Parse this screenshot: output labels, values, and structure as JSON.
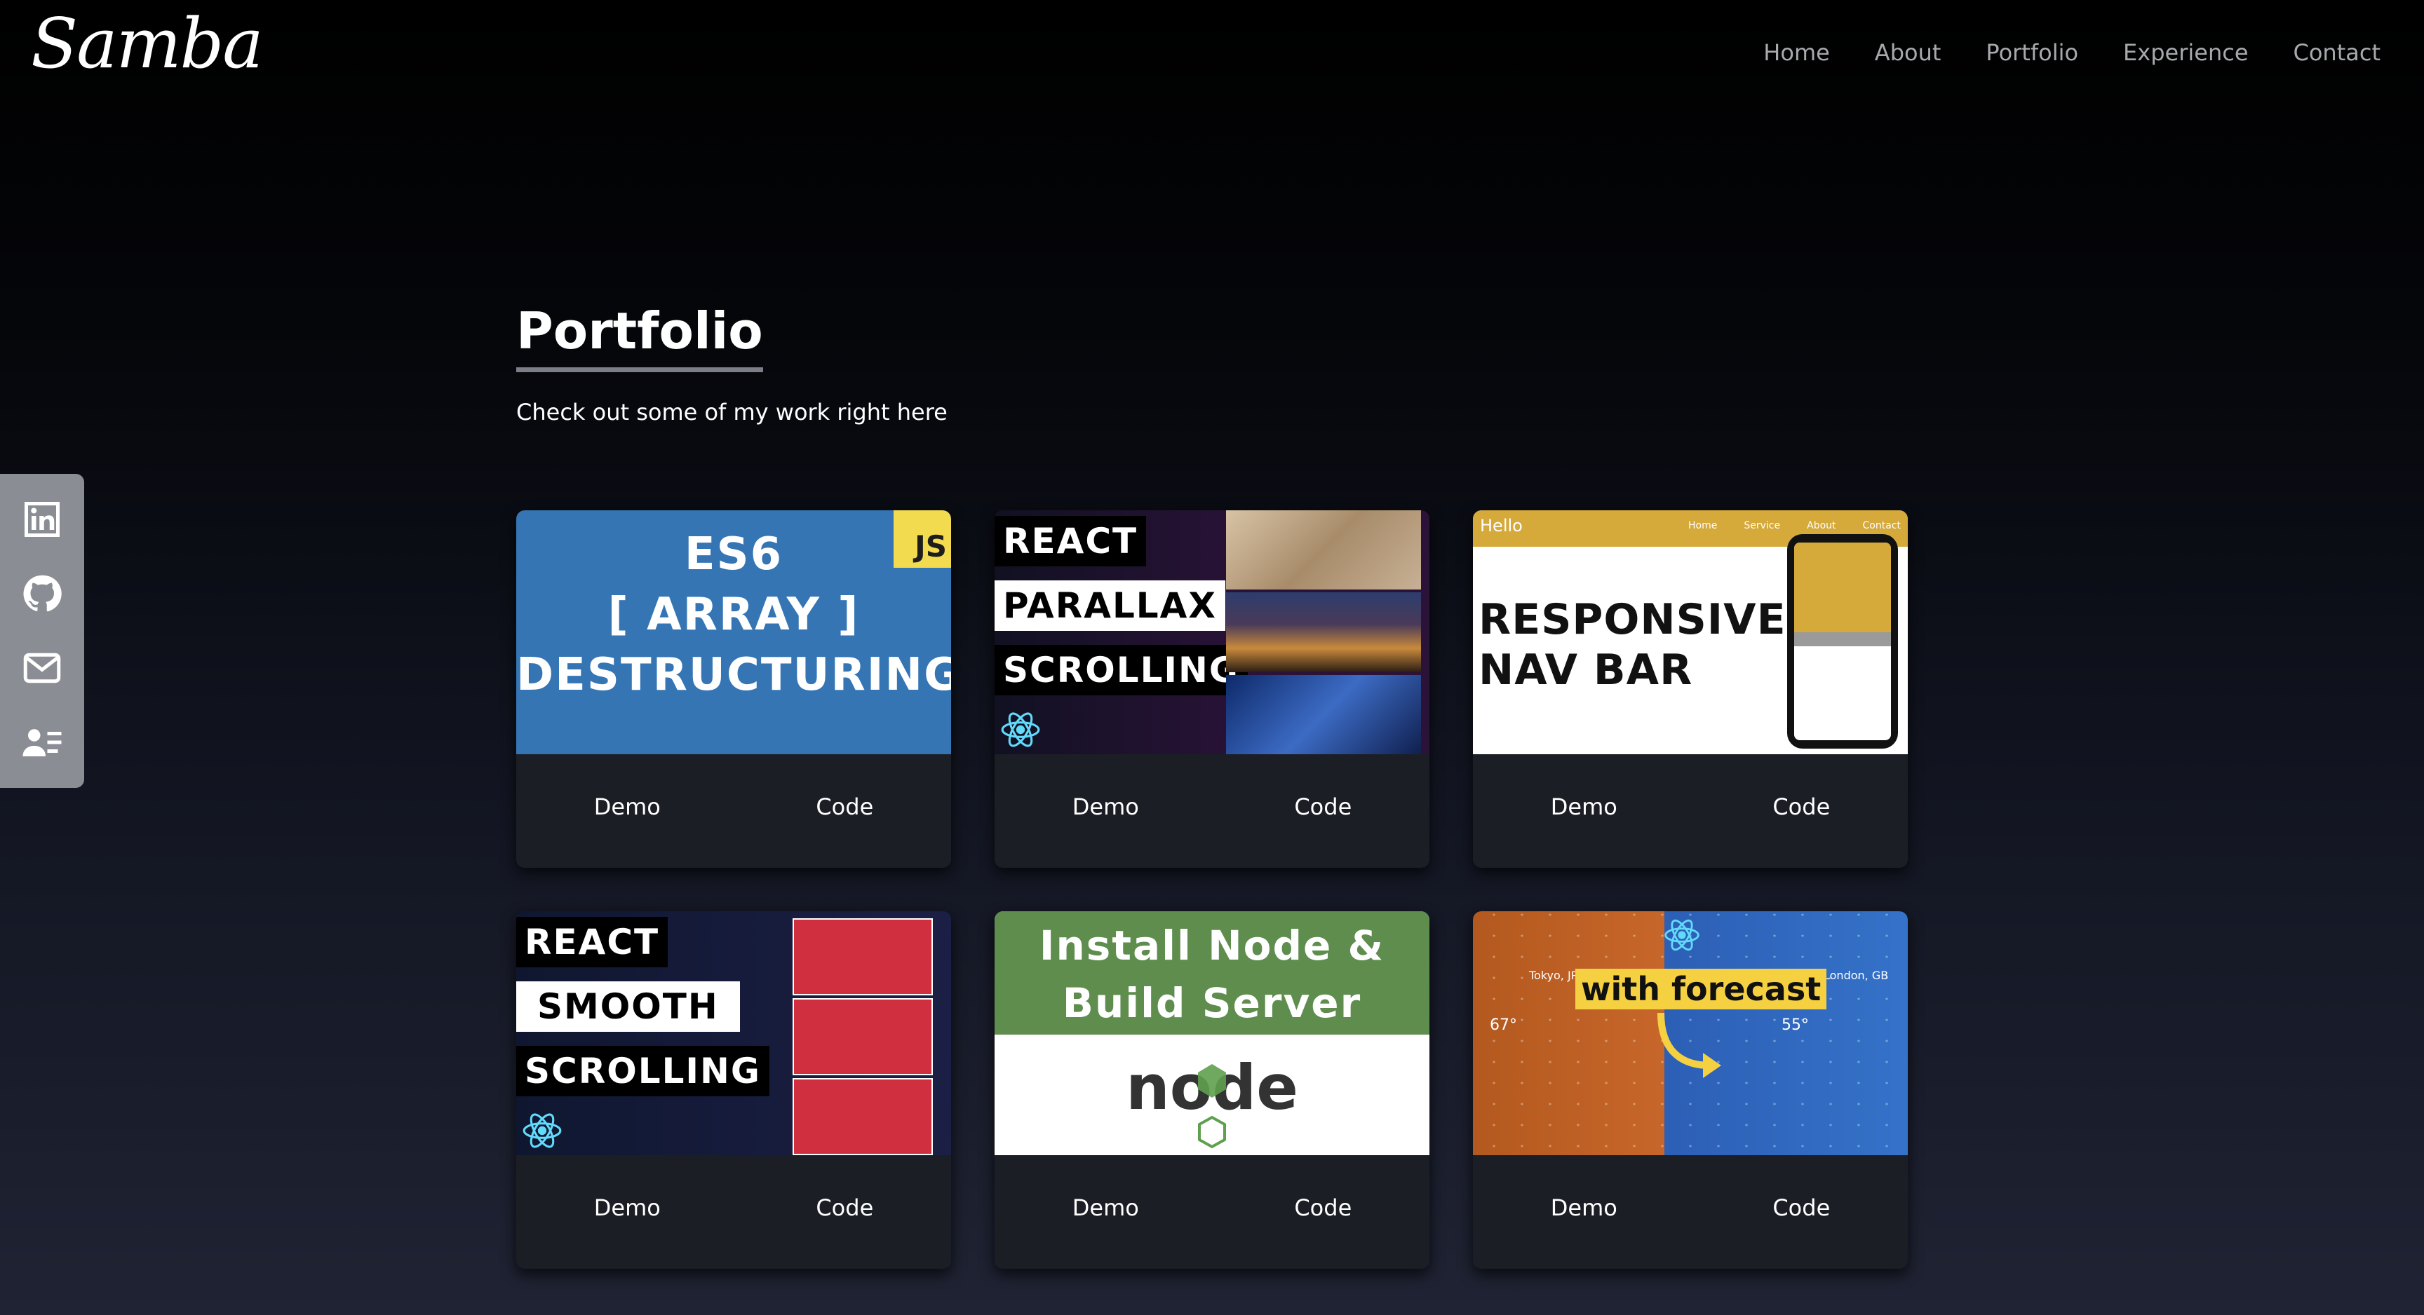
{
  "header": {
    "logo": "Samba",
    "nav": [
      "Home",
      "About",
      "Portfolio",
      "Experience",
      "Contact"
    ]
  },
  "social": [
    {
      "icon": "linkedin-icon"
    },
    {
      "icon": "github-icon"
    },
    {
      "icon": "mail-icon"
    },
    {
      "icon": "resume-icon"
    }
  ],
  "section": {
    "title": "Portfolio",
    "subtitle": "Check out some of my work right here"
  },
  "cards": [
    {
      "thumb": {
        "badge": "JS",
        "lines": [
          "ES6",
          "[ ARRAY ]",
          "DESTRUCTURING"
        ]
      },
      "demo": "Demo",
      "code": "Code"
    },
    {
      "thumb": {
        "tags": [
          "REACT",
          "PARALLAX",
          "SCROLLING"
        ]
      },
      "demo": "Demo",
      "code": "Code"
    },
    {
      "thumb": {
        "hello": "Hello",
        "links": [
          "Home",
          "Service",
          "About",
          "Contact"
        ],
        "lines": [
          "RESPONSIVE",
          "NAV BAR"
        ]
      },
      "demo": "Demo",
      "code": "Code"
    },
    {
      "thumb": {
        "tags": [
          "REACT",
          "SMOOTH",
          "SCROLLING"
        ]
      },
      "demo": "Demo",
      "code": "Code"
    },
    {
      "thumb": {
        "lines": [
          "Install Node &",
          "Build Server"
        ],
        "logo_text": "node"
      },
      "demo": "Demo",
      "code": "Code"
    },
    {
      "thumb": {
        "tag": "with forecast",
        "city_left": "Tokyo, JP",
        "temp_left": "67°",
        "city_right": "London, GB",
        "temp_right": "55°"
      },
      "demo": "Demo",
      "code": "Code"
    }
  ],
  "colors": {
    "accent_underline": "#7b7e86",
    "sidebar": "#8a8d93",
    "nav_text": "#a7a9ad"
  }
}
